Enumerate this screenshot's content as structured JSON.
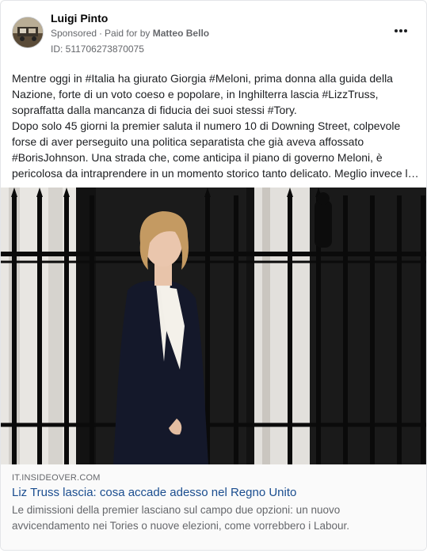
{
  "post": {
    "author": "Luigi Pinto",
    "sponsored_label": "Sponsored",
    "paid_for_label": "Paid for by",
    "payer": "Matteo Bello",
    "ad_id": "ID: 511706273870075",
    "more_icon": "more-horizontal-icon",
    "body_paragraph_1": "Mentre oggi in #Italia ha giurato Giorgia #Meloni, prima donna alla guida della Nazione, forte di un voto coeso e popolare, in Inghilterra lascia #LizzTruss, sopraffatta dalla mancanza di fiducia dei suoi stessi #Tory.",
    "body_paragraph_2": "Dopo solo 45 giorni la premier saluta il numero 10 di Downing Street, colpevole forse di aver perseguito una politica separatista che già aveva affossato #BorisJohnson. Una strada che, come anticipa il piano di governo Meloni, è pericolosa da intraprendere in un momento storico tanto delicato. Meglio invece l…"
  },
  "link": {
    "domain": "IT.INSIDEOVER.COM",
    "headline": "Liz Truss lascia: cosa accade adesso nel Regno Unito",
    "description": "Le dimissioni della premier lasciano sul campo due opzioni: un nuovo avvicendamento nei Tories o nuove elezioni, come vorrebbero i Labour."
  },
  "colors": {
    "link_headline": "#1a4d8f",
    "meta_gray": "#65676b"
  }
}
